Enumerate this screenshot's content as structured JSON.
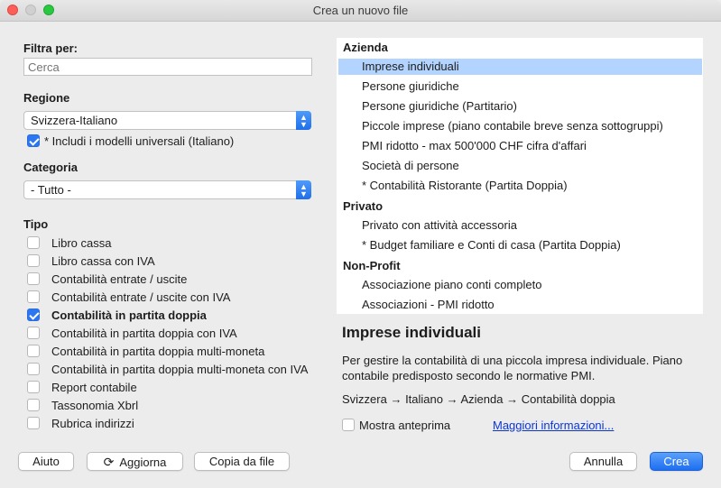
{
  "window": {
    "title": "Crea un nuovo file"
  },
  "filter": {
    "label": "Filtra per:",
    "placeholder": "Cerca",
    "value": ""
  },
  "region": {
    "label": "Regione",
    "selected": "Svizzera-Italiano",
    "include_universal": {
      "label": "* Includi i modelli universali (Italiano)",
      "checked": true
    }
  },
  "category": {
    "label": "Categoria",
    "selected": "- Tutto -"
  },
  "tipo": {
    "label": "Tipo",
    "items": [
      {
        "label": "Libro cassa",
        "checked": false
      },
      {
        "label": "Libro cassa con IVA",
        "checked": false
      },
      {
        "label": "Contabilità entrate / uscite",
        "checked": false
      },
      {
        "label": "Contabilità entrate / uscite con IVA",
        "checked": false
      },
      {
        "label": "Contabilità in partita doppia",
        "checked": true
      },
      {
        "label": "Contabilità in partita doppia con IVA",
        "checked": false
      },
      {
        "label": "Contabilità in partita doppia multi-moneta",
        "checked": false
      },
      {
        "label": "Contabilità in partita doppia multi-moneta con IVA",
        "checked": false
      },
      {
        "label": "Report contabile",
        "checked": false
      },
      {
        "label": "Tassonomia Xbrl",
        "checked": false
      },
      {
        "label": "Rubrica indirizzi",
        "checked": false
      }
    ]
  },
  "templates": {
    "groups": [
      {
        "name": "Azienda",
        "items": [
          "Imprese individuali",
          "Persone giuridiche",
          "Persone giuridiche (Partitario)",
          "Piccole imprese (piano contabile breve senza sottogruppi)",
          "PMI ridotto - max 500'000 CHF cifra d'affari",
          "Società di persone",
          "* Contabilità Ristorante (Partita Doppia)"
        ]
      },
      {
        "name": "Privato",
        "items": [
          "Privato con attività accessoria",
          "* Budget familiare e Conti di casa (Partita Doppia)"
        ]
      },
      {
        "name": "Non-Profit",
        "items": [
          "Associazione piano conti completo",
          "Associazioni - PMI ridotto"
        ]
      }
    ],
    "selected": "Imprese individuali"
  },
  "description": {
    "title": "Imprese individuali",
    "text": "Per gestire la contabilità di una piccola impresa individuale. Piano contabile predisposto secondo le normative PMI.",
    "path": "Svizzera → Italiano → Azienda → Contabilità doppia"
  },
  "preview": {
    "label": "Mostra anteprima",
    "checked": false
  },
  "more_info": "Maggiori informazioni...",
  "buttons": {
    "help": "Aiuto",
    "refresh": "Aggiorna",
    "copy": "Copia da file",
    "cancel": "Annulla",
    "create": "Crea"
  },
  "colors": {
    "accent": "#2b77f2",
    "selection": "#b3d4fe",
    "link": "#0b36d6"
  }
}
